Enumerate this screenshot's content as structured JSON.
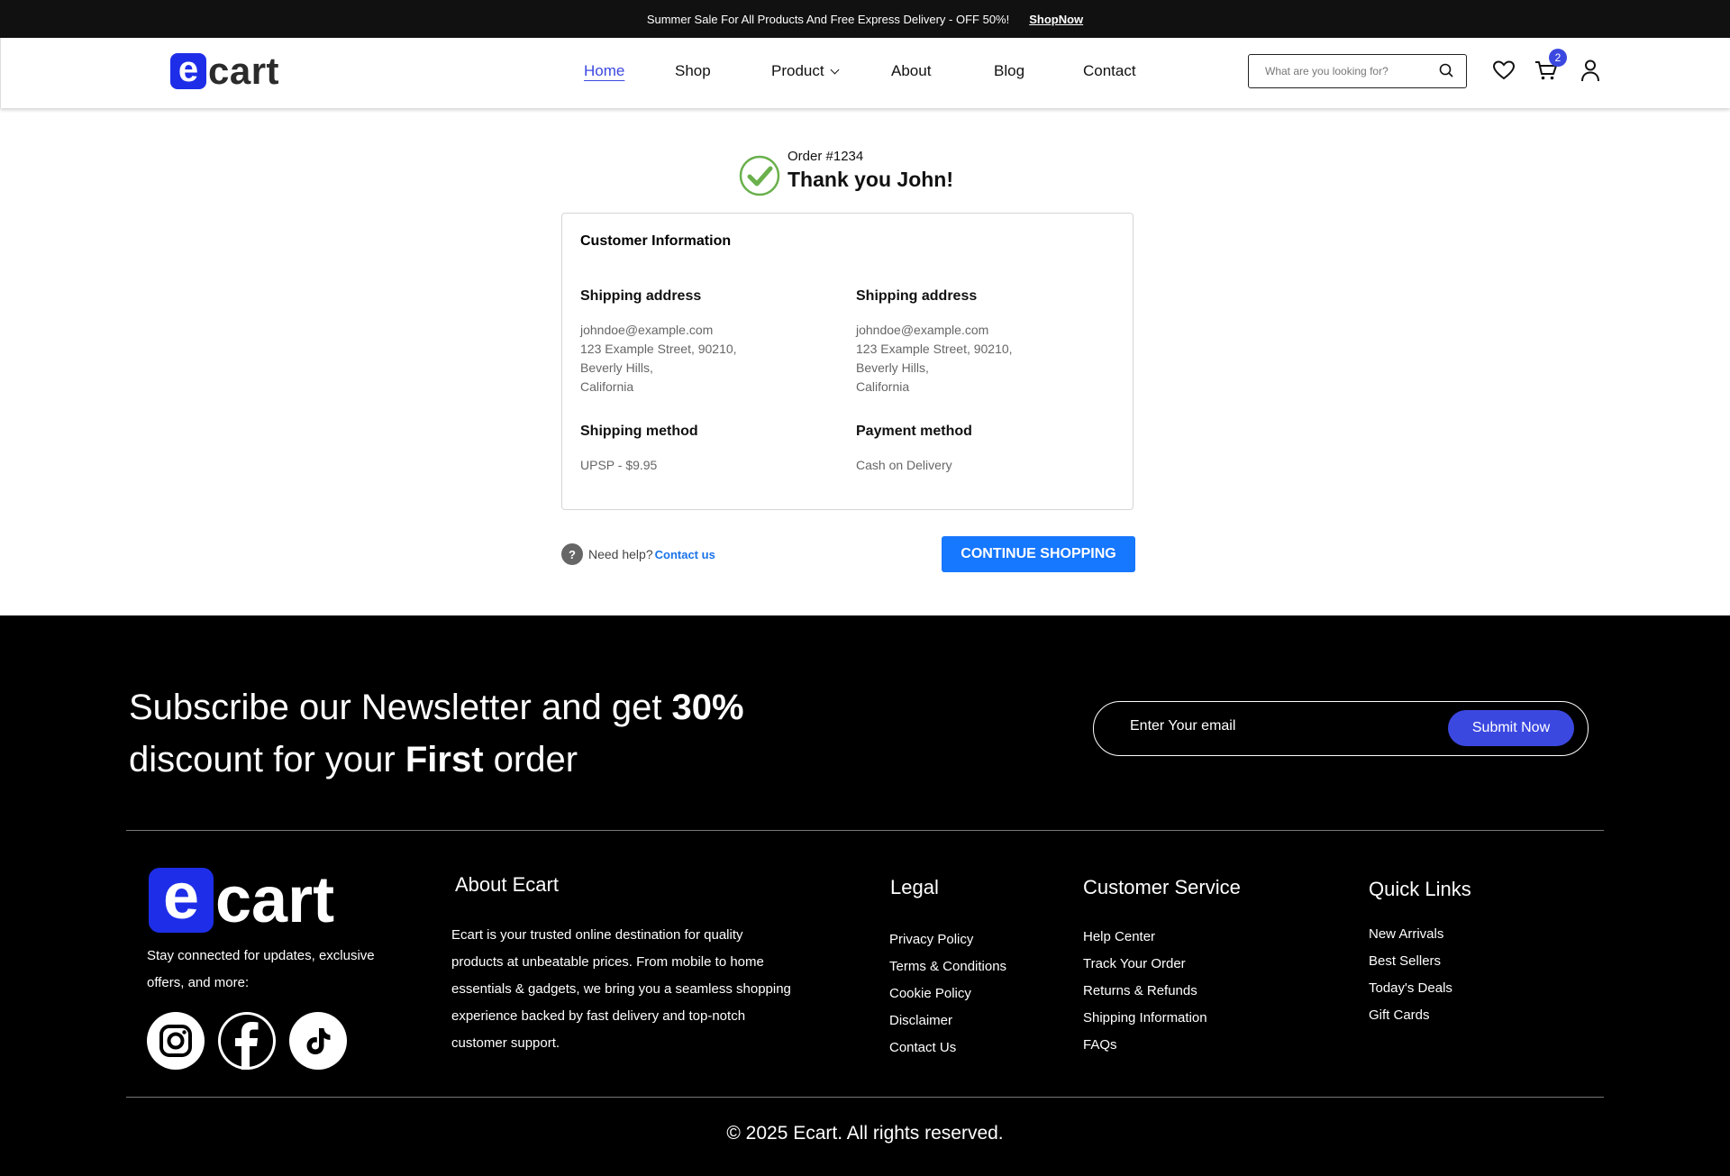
{
  "announcement": {
    "text": "Summer Sale For All Products And Free Express Delivery - OFF 50%!",
    "link": "ShopNow"
  },
  "header": {
    "logo_letter": "e",
    "logo_text": "cart",
    "nav": [
      "Home",
      "Shop",
      "Product",
      "About",
      "Blog",
      "Contact"
    ],
    "active_nav": "Home",
    "search_placeholder": "What are you looking for?",
    "cart_count": "2"
  },
  "order": {
    "number": "Order #1234",
    "thanks": "Thank you John!",
    "card_title": "Customer Information",
    "left": {
      "heading": "Shipping address",
      "lines": [
        "johndoe@example.com",
        "123 Example Street, 90210,",
        "Beverly Hills,",
        "California"
      ],
      "method_heading": "Shipping method",
      "method_value": "UPSP - $9.95"
    },
    "right": {
      "heading": "Shipping address",
      "lines": [
        "johndoe@example.com",
        "123 Example Street, 90210,",
        "Beverly Hills,",
        "California"
      ],
      "method_heading": "Payment method",
      "method_value": "Cash on Delivery"
    },
    "help_text": "Need help?",
    "help_link": "Contact us",
    "continue_label": "CONTINUE SHOPPING"
  },
  "footer": {
    "newsletter": {
      "part1": "Subscribe our Newsletter and get ",
      "bold1": "30%",
      "part2": "discount for your ",
      "bold2": "First",
      "part3": " order"
    },
    "email_placeholder": "Enter Your email",
    "submit_label": "Submit Now",
    "logo_letter": "e",
    "logo_text": "cart",
    "tagline": "Stay connected for updates, exclusive offers, and more:",
    "about_heading": "About Ecart",
    "about_text": "Ecart is your trusted online destination for quality products at unbeatable prices. From mobile to home essentials & gadgets, we bring you a seamless shopping experience backed by fast delivery and top-notch customer support.",
    "legal_heading": "Legal",
    "legal": [
      "Privacy Policy",
      "Terms & Conditions",
      "Cookie Policy",
      "Disclaimer",
      "Contact Us"
    ],
    "service_heading": "Customer Service",
    "service": [
      "Help Center",
      "Track Your Order",
      "Returns & Refunds",
      "Shipping Information",
      "FAQs"
    ],
    "quick_heading": "Quick Links",
    "quick": [
      "New Arrivals",
      "Best Sellers",
      "Today's Deals",
      "Gift Cards"
    ],
    "copyright": "© 2025 Ecart. All rights reserved."
  },
  "colors": {
    "brand": "#3b48e0",
    "logo": "#1e2ee8",
    "cta": "#1677ff",
    "check": "#6ab04c"
  }
}
